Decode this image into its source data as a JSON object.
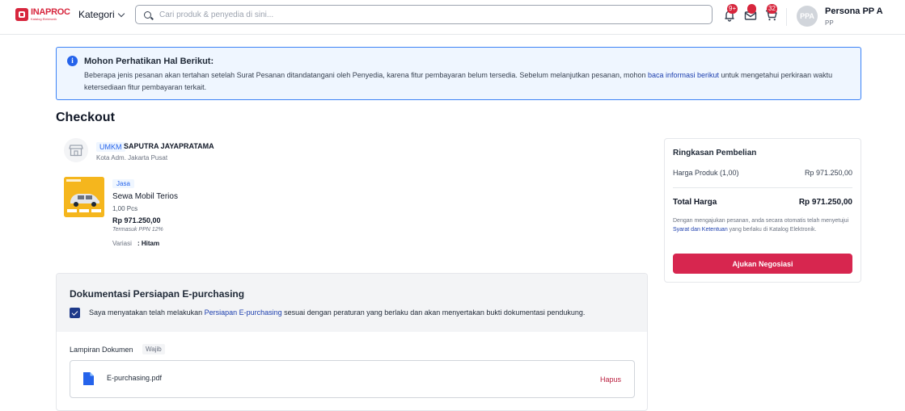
{
  "header": {
    "logo_title": "INAPROC",
    "logo_sub": "Katalog Elektronik",
    "kategori_label": "Kategori",
    "search_placeholder": "Cari produk & penyedia di sini...",
    "notif_badge": "9+",
    "cart_badge": "32",
    "avatar_initials": "PPA",
    "user_name": "Persona PP A",
    "user_role": "PP"
  },
  "alert": {
    "title": "Mohon Perhatikan Hal Berikut:",
    "body_before": "Beberapa jenis pesanan akan tertahan setelah Surat Pesanan ditandatangani oleh Penyedia, karena fitur pembayaran belum tersedia. Sebelum melanjutkan pesanan, mohon ",
    "body_link": "baca informasi berikut",
    "body_after": " untuk mengetahui perkiraan waktu ketersediaan fitur pembayaran terkait."
  },
  "page_title": "Checkout",
  "seller": {
    "badge": "UMKM",
    "name": "SAPUTRA JAYAPRATAMA",
    "location": "Kota Adm. Jakarta Pusat"
  },
  "product": {
    "tag": "Jasa",
    "name": "Sewa Mobil Terios",
    "qty": "1,00 Pcs",
    "price": "Rp 971.250,00",
    "tax_note": "Termasuk PPN 12%",
    "variant_label": "Variasi",
    "variant_value": ": Hitam"
  },
  "summary": {
    "title": "Ringkasan Pembelian",
    "row_label": "Harga Produk (1,00)",
    "row_value": "Rp 971.250,00",
    "total_label": "Total Harga",
    "total_value": "Rp 971.250,00",
    "note_before": "Dengan mengajukan pesanan, anda secara otomatis telah menyetujui ",
    "note_link": "Syarat dan Ketentuan",
    "note_after": " yang berlaku di Katalog Elektronik.",
    "button_label": "Ajukan Negosiasi"
  },
  "documents": {
    "title": "Dokumentasi Persiapan E-purchasing",
    "statement_before": "Saya menyatakan telah melakukan ",
    "statement_link": "Persiapan E-purchasing",
    "statement_after": " sesuai dengan peraturan yang berlaku dan akan menyertakan bukti dokumentasi pendukung.",
    "attachment_label": "Lampiran Dokumen",
    "required_badge": "Wajib",
    "file_name": "E-purchasing.pdf",
    "delete_label": "Hapus"
  },
  "colors": {
    "brand": "#d7263d",
    "button": "#d7264f",
    "link": "#1e40af",
    "info_border": "#3b82f6"
  },
  "icons": [
    "search-icon",
    "bell-icon",
    "mail-icon",
    "cart-icon",
    "info-icon",
    "store-icon",
    "checkbox-check-icon",
    "file-icon",
    "chevron-down-icon"
  ]
}
